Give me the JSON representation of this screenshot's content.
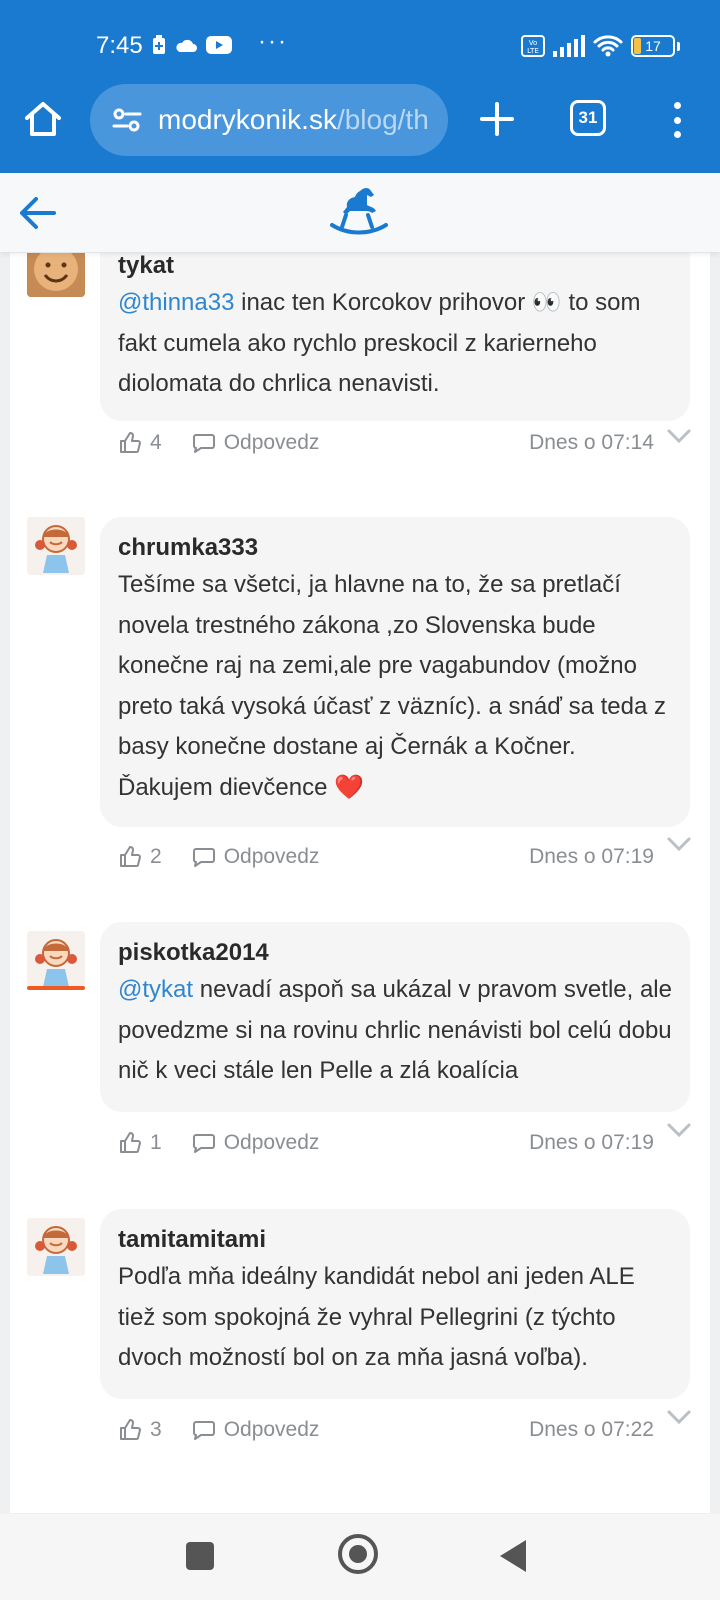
{
  "status_bar": {
    "time": "7:45",
    "dots": "···",
    "volte": "VoLTE",
    "battery_level": "17"
  },
  "browser": {
    "url_domain": "modrykonik.sk",
    "url_path": "/blog/th",
    "tab_count": "31"
  },
  "colors": {
    "brand": "#1a7ad0",
    "mention": "#2f86cf",
    "heart": "#e8342a"
  },
  "comments": [
    {
      "author": "tykat",
      "text_parts": [
        {
          "mention": "@thinna33"
        },
        {
          "text": " inac ten Korcokov prihovor 👀 to som fakt cumela ako rychlo preskocil z karierneho diolomata do chrlica nenavisti."
        }
      ],
      "mention": "@thinna33",
      "text": " inac ten Korcokov prihovor 👀 to som fakt cumela ako rychlo preskocil z karierneho diolomata do chrlica nenavisti.",
      "likes": "4",
      "reply_label": "Odpovedz",
      "timestamp": "Dnes o 07:14"
    },
    {
      "author": "chrumka333",
      "text": "Tešíme sa všetci, ja hlavne na to, že sa pretlačí novela trestného zákona ,zo Slovenska bude konečne raj na zemi,ale pre vagabundov (možno preto taká vysoká účasť z väzníc). a snáď sa teda z basy konečne dostane aj Černák a Kočner. Ďakujem dievčence ❤️",
      "likes": "2",
      "reply_label": "Odpovedz",
      "timestamp": "Dnes o 07:19"
    },
    {
      "author": "piskotka2014",
      "mention": "@tykat",
      "text": " nevadí aspoň sa ukázal v pravom svetle, ale povedzme si na rovinu chrlic nenávisti bol celú dobu nič k veci stále len Pelle a zlá koalícia",
      "likes": "1",
      "reply_label": "Odpovedz",
      "timestamp": "Dnes o 07:19"
    },
    {
      "author": "tamitamitami",
      "text": "Podľa mňa ideálny kandidát nebol ani jeden ALE tiež som spokojná že vyhral Pellegrini (z týchto dvoch možností bol on za mňa jasná voľba).",
      "likes": "3",
      "reply_label": "Odpovedz",
      "timestamp": "Dnes o 07:22"
    }
  ]
}
